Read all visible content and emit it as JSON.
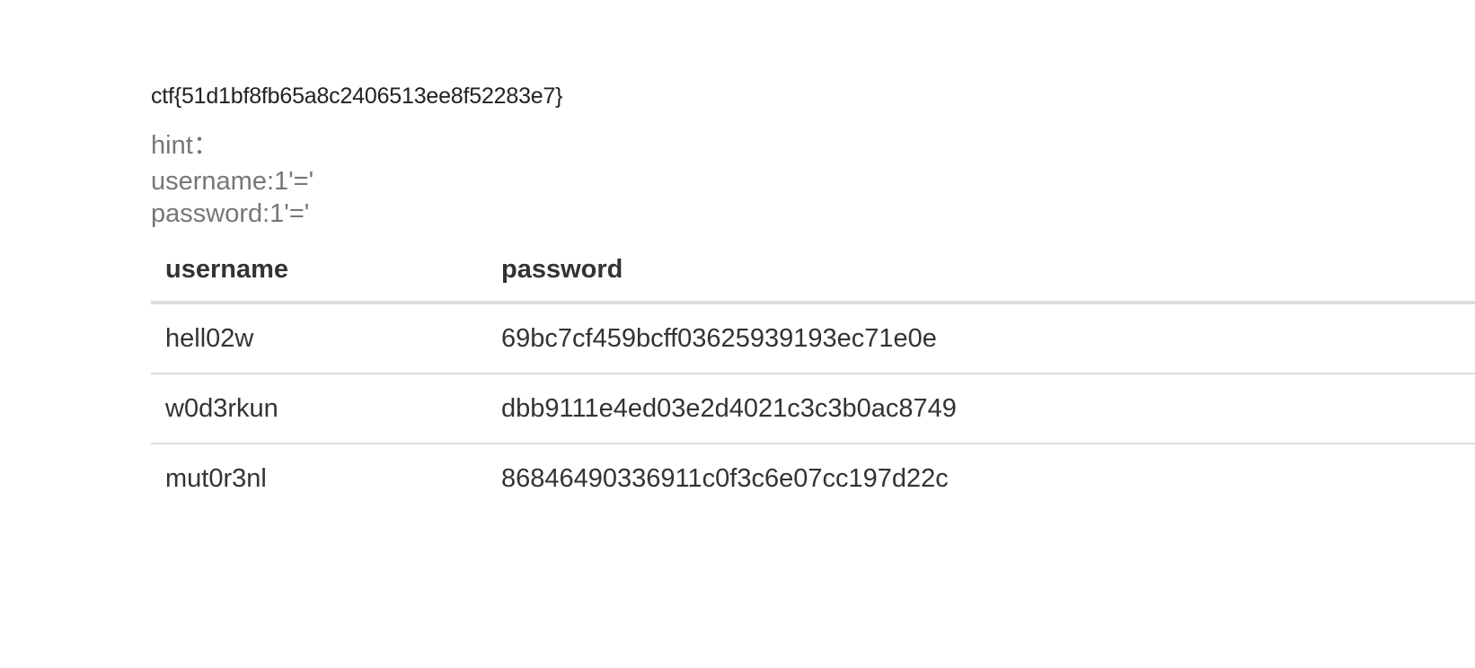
{
  "flag": "ctf{51d1bf8fb65a8c2406513ee8f52283e7}",
  "hint": {
    "title": "hint：",
    "lines": [
      "username:1'='",
      "password:1'='"
    ]
  },
  "table": {
    "headers": [
      "username",
      "password"
    ],
    "rows": [
      [
        "hell02w",
        "69bc7cf459bcff03625939193ec71e0e"
      ],
      [
        "w0d3rkun",
        "dbb9111e4ed03e2d4021c3c3b0ac8749"
      ],
      [
        "mut0r3nl",
        "86846490336911c0f3c6e07cc197d22c"
      ]
    ]
  }
}
